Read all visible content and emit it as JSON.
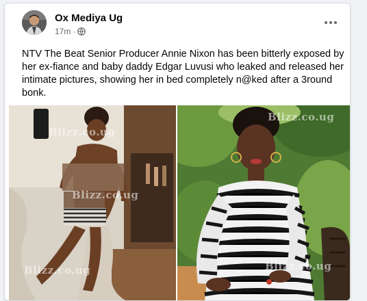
{
  "post": {
    "author": "Ox Mediya Ug",
    "time": "17m",
    "separator": "·",
    "privacy_icon": "globe-icon",
    "more_icon": "more-dots-icon",
    "text": "NTV The Beat Senior Producer Annie Nixon has been bitterly exposed by her ex-fiance and baby daddy Edgar Luvusi who leaked and released her intimate pictures, showing her in bed completely n@ked after a 3round bonk."
  },
  "photos": {
    "left": {
      "watermark_top": "Blizz.co.ug",
      "watermark_mid": "Blizz.co.ug",
      "watermark_bottom": "Blizz.co.ug"
    },
    "right": {
      "watermark_top": "Blizz.co.ug",
      "watermark_bottom": "Blizz.co.ug"
    }
  },
  "colors": {
    "card_bg": "#ffffff",
    "page_bg": "#f0f2f5",
    "meta_text": "#65676b",
    "body_text": "#050505"
  }
}
